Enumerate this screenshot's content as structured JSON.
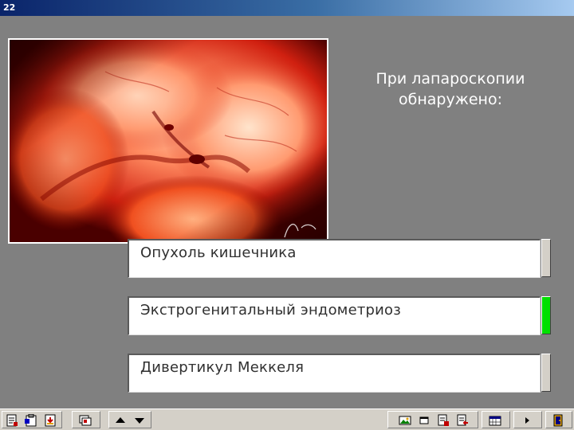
{
  "window": {
    "title": "22"
  },
  "question": {
    "text": "При лапароскопии обнаружено:"
  },
  "answers": [
    {
      "label": "Опухоль кишечника",
      "correct": false
    },
    {
      "label": "Экстрогенитальный эндометриоз",
      "correct": true
    },
    {
      "label": "Дивертикул Меккеля",
      "correct": false
    }
  ],
  "colors": {
    "correct": "#00e000",
    "neutral": "#d4d0c8",
    "background": "#808080"
  },
  "toolbar": {
    "icons": [
      "notes-icon",
      "clipboard-icon",
      "download-icon",
      "slides-icon",
      "arrow-up-icon",
      "arrow-down-icon",
      "image-icon",
      "window-icon",
      "edit-page-icon",
      "page-back-icon",
      "calendar-icon",
      "play-icon",
      "exit-door-icon"
    ]
  }
}
